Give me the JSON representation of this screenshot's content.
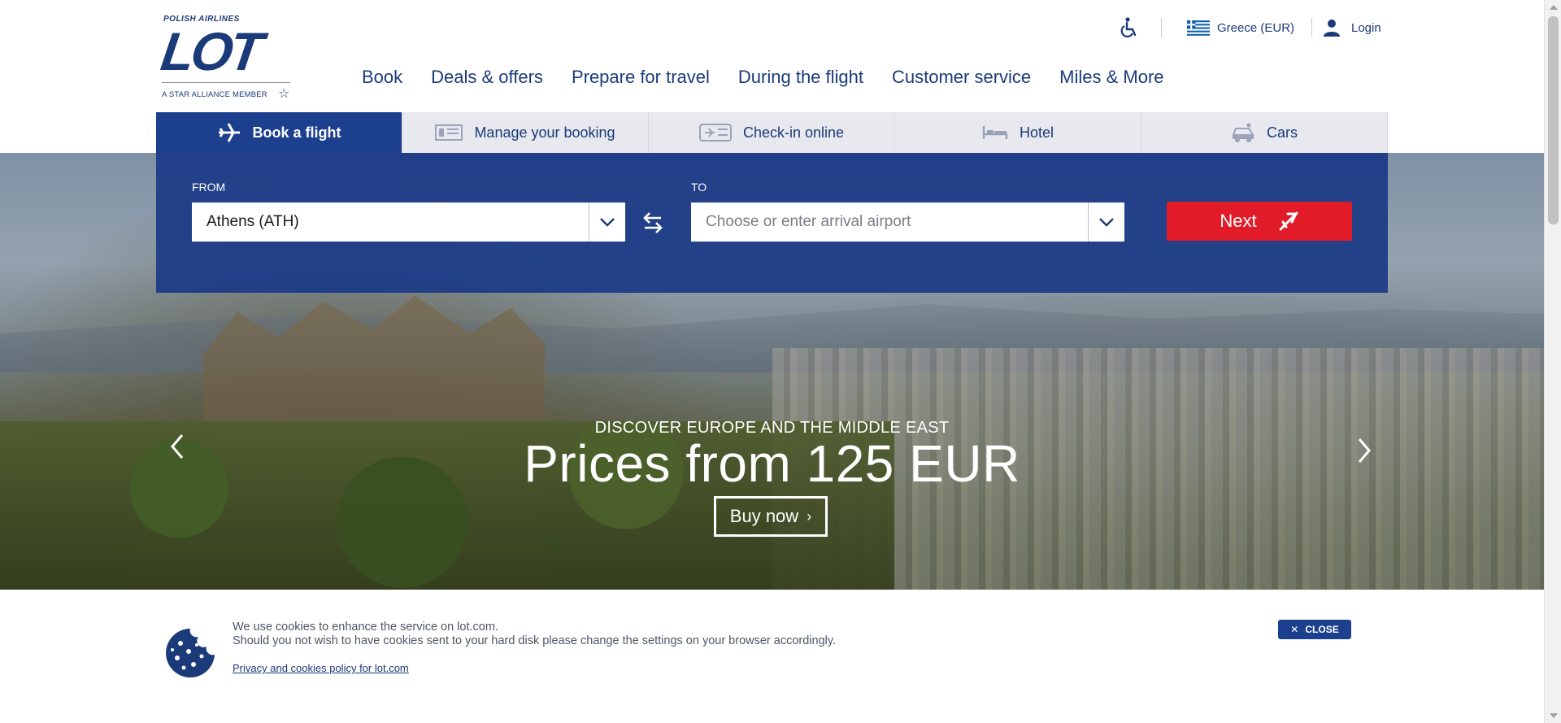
{
  "brand": {
    "airline_small": "POLISH AIRLINES",
    "logo_word": "LOT",
    "alliance": "A STAR ALLIANCE MEMBER"
  },
  "utility": {
    "accessibility_icon": "wheelchair-icon",
    "country": "Greece (EUR)",
    "login": "Login"
  },
  "nav": {
    "items": [
      "Book",
      "Deals & offers",
      "Prepare for travel",
      "During the flight",
      "Customer service",
      "Miles & More"
    ]
  },
  "tabs": [
    {
      "label": "Book a flight",
      "icon": "plane-icon",
      "active": true
    },
    {
      "label": "Manage your booking",
      "icon": "ticket-icon",
      "active": false
    },
    {
      "label": "Check-in online",
      "icon": "boarding-pass-icon",
      "active": false
    },
    {
      "label": "Hotel",
      "icon": "bed-icon",
      "active": false
    },
    {
      "label": "Cars",
      "icon": "car-icon",
      "active": false
    }
  ],
  "booking": {
    "from_label": "FROM",
    "from_value": "Athens (ATH)",
    "to_label": "TO",
    "to_placeholder": "Choose or enter arrival airport",
    "next_label": "Next"
  },
  "hero": {
    "kicker": "DISCOVER EUROPE AND THE MIDDLE EAST",
    "headline": "Prices from 125 EUR",
    "cta": "Buy now"
  },
  "cookie": {
    "line1": "We use cookies to enhance the service on lot.com.",
    "line2": "Should you not wish to have cookies sent to your hard disk please change the settings on your browser accordingly.",
    "policy_link": "Privacy and cookies policy for lot.com",
    "close_label": "CLOSE"
  },
  "colors": {
    "brand_blue": "#1b3a7a",
    "panel_blue": "#1c3f8e",
    "cta_red": "#e21b29"
  }
}
